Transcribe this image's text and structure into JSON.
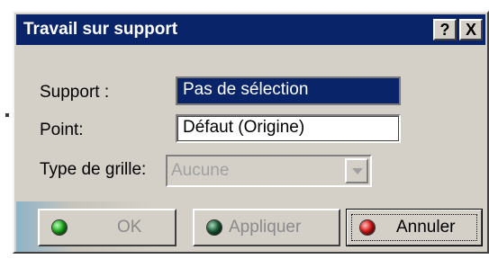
{
  "window": {
    "title": "Travail sur support",
    "help_glyph": "?",
    "close_glyph": "X"
  },
  "form": {
    "support_label": "Support :",
    "support_value": "Pas de sélection",
    "point_label": "Point:",
    "point_value": "Défaut (Origine)",
    "grid_label": "Type de grille:",
    "grid_value": "Aucune"
  },
  "buttons": {
    "ok": "OK",
    "apply": "Appliquer",
    "cancel": "Annuler"
  },
  "colors": {
    "title_bar": "#0a246a",
    "dialog_face": "#d4d0c8",
    "ok_led": "#1fa81f",
    "apply_led": "#1f5f3a",
    "cancel_led": "#d81818"
  },
  "icons": {
    "ok": "green-led-icon",
    "apply": "dark-green-led-icon",
    "cancel": "red-led-icon",
    "dropdown": "chevron-down-icon"
  }
}
